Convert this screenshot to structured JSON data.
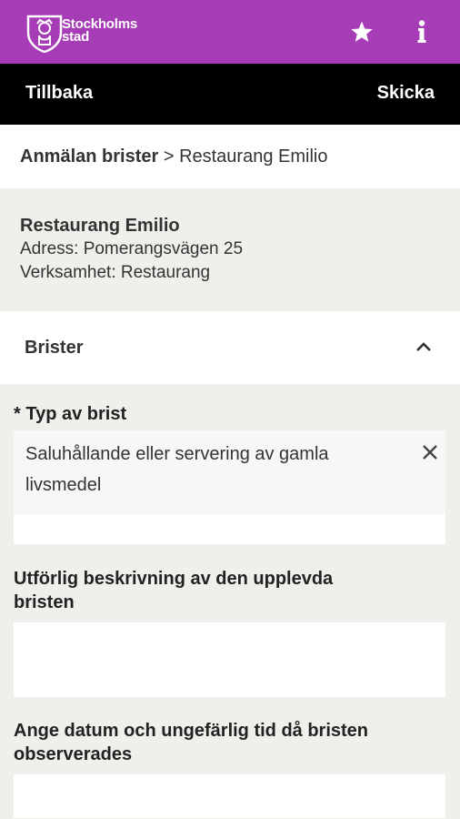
{
  "header": {
    "logo_line1": "Stockholms",
    "logo_line2": "stad",
    "brand_color": "#a63cb6",
    "icons": [
      "star-icon",
      "info-icon"
    ]
  },
  "nav": {
    "back_label": "Tillbaka",
    "send_label": "Skicka"
  },
  "breadcrumb": {
    "root": "Anmälan brister",
    "separator": " > ",
    "current": "Restaurang Emilio"
  },
  "business": {
    "name": "Restaurang Emilio",
    "address": "Adress: Pomerangsvägen 25",
    "activity": "Verksamhet: Restaurang"
  },
  "section": {
    "title": "Brister",
    "icon": "chevron-up-icon"
  },
  "form": {
    "type_label": "* Typ av brist",
    "type_value": "Saluhållande eller servering av gamla livsmedel",
    "description_label": "Utförlig beskrivning av den upplevda bristen",
    "description_value": "",
    "date_label": "Ange datum och ungefärlig tid då bristen observerades",
    "date_value": ""
  }
}
